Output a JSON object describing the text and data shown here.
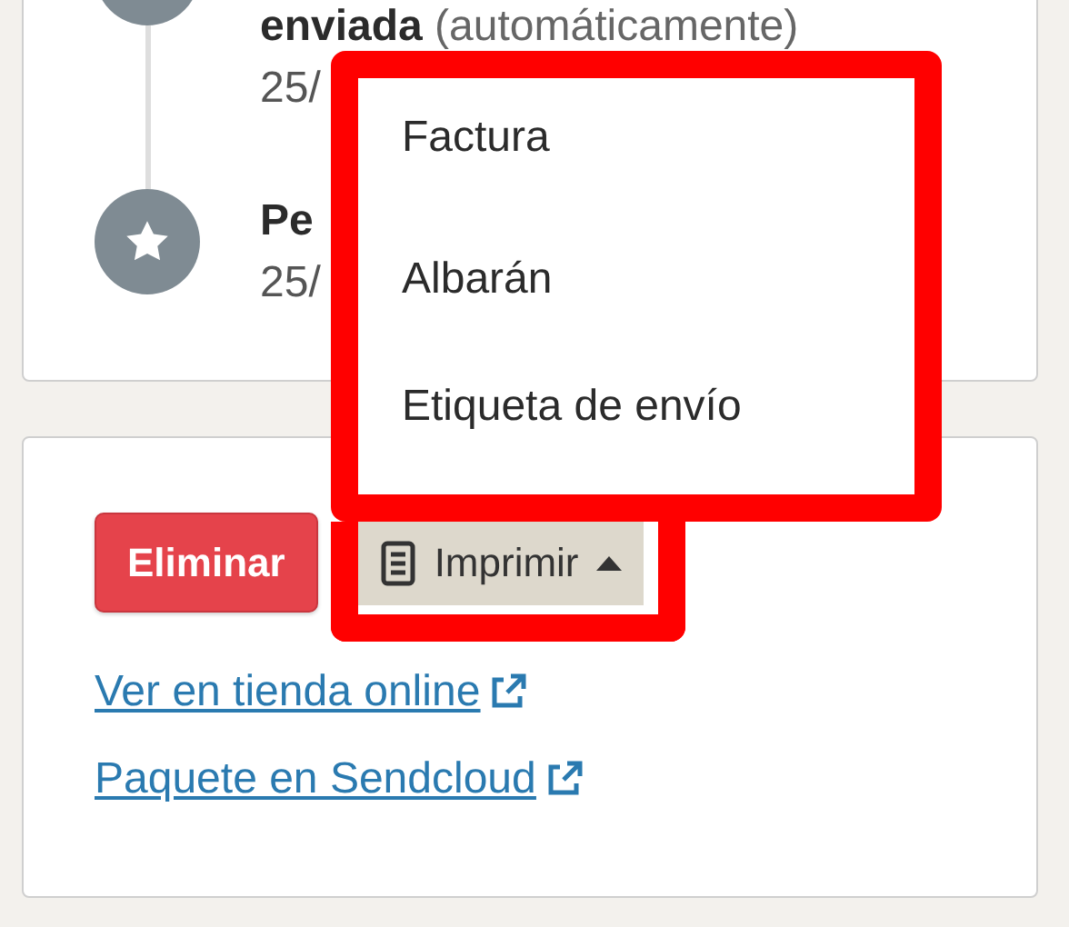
{
  "timeline": [
    {
      "text": "**enviada** (automáticamente)",
      "date": "25/",
      "kind": "plain"
    },
    {
      "text": "**Pe**",
      "date": "25/",
      "kind": "star"
    }
  ],
  "actions": [
    {
      "label": "Eliminar",
      "kind": "danger"
    },
    {
      "label": "Imprimir",
      "kind": "menu",
      "expanded": true
    }
  ],
  "print_menu": {
    "items": [
      {
        "label": "Factura"
      },
      {
        "label": "Albarán"
      },
      {
        "label": "Etiqueta de envío"
      }
    ]
  },
  "links": [
    {
      "label": "Ver en tienda online"
    },
    {
      "label": "Paquete en Sendcloud"
    }
  ]
}
